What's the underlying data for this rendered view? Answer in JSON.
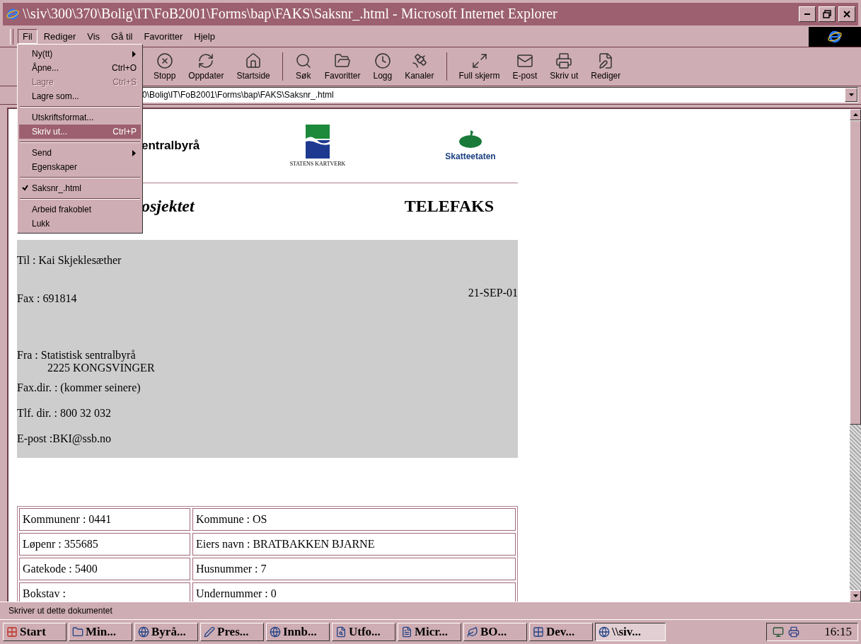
{
  "window": {
    "title": "\\\\siv\\300\\370\\Bolig\\IT\\FoB2001\\Forms\\bap\\FAKS\\Saksnr_.html - Microsoft Internet Explorer"
  },
  "menubar": [
    {
      "label": "Fil",
      "selected": true
    },
    {
      "label": "Rediger",
      "selected": false
    },
    {
      "label": "Vis",
      "selected": false
    },
    {
      "label": "Gå til",
      "selected": false
    },
    {
      "label": "Favoritter",
      "selected": false
    },
    {
      "label": "Hjelp",
      "selected": false
    }
  ],
  "toolbar": [
    [
      {
        "label": "Stopp"
      },
      {
        "label": "Oppdater"
      },
      {
        "label": "Startside"
      }
    ],
    [
      {
        "label": "Søk"
      },
      {
        "label": "Favoritter"
      },
      {
        "label": "Logg"
      },
      {
        "label": "Kanaler"
      }
    ],
    [
      {
        "label": "Full skjerm"
      },
      {
        "label": "E-post"
      },
      {
        "label": "Skriv ut"
      },
      {
        "label": "Rediger"
      }
    ]
  ],
  "address": {
    "value": "0\\Bolig\\IT\\FoB2001\\Forms\\bap\\FAKS\\Saksnr_.html"
  },
  "file_menu": [
    [
      {
        "label": "Ny(tt)",
        "submenu": true,
        "disabled": false,
        "checked": false,
        "selected": false
      },
      {
        "label": "Åpne...",
        "shortcut": "Ctrl+O",
        "submenu": false,
        "disabled": false,
        "checked": false,
        "selected": false
      },
      {
        "label": "Lagre",
        "shortcut": "Ctrl+S",
        "submenu": false,
        "disabled": true,
        "checked": false,
        "selected": false
      },
      {
        "label": "Lagre som...",
        "submenu": false,
        "disabled": false,
        "checked": false,
        "selected": false
      }
    ],
    [
      {
        "label": "Utskriftsformat...",
        "submenu": false,
        "disabled": false,
        "checked": false,
        "selected": false
      },
      {
        "label": "Skriv ut...",
        "shortcut": "Ctrl+P",
        "submenu": false,
        "disabled": false,
        "checked": false,
        "selected": true
      }
    ],
    [
      {
        "label": "Send",
        "submenu": true,
        "disabled": false,
        "checked": false,
        "selected": false
      },
      {
        "label": "Egenskaper",
        "submenu": false,
        "disabled": false,
        "checked": false,
        "selected": false
      }
    ],
    [
      {
        "label": "Saksnr_.html",
        "submenu": false,
        "disabled": false,
        "checked": true,
        "selected": false
      }
    ],
    [
      {
        "label": "Arbeid frakoblet",
        "submenu": false,
        "disabled": false,
        "checked": false,
        "selected": false
      },
      {
        "label": "Lukk",
        "submenu": false,
        "disabled": false,
        "checked": false,
        "selected": false
      }
    ]
  ],
  "page": {
    "ssb_text": "entralbyrå",
    "kartverk_text": "STATENS KARTVERK",
    "skatt_text": "Skatteetaten",
    "project": "osjektet",
    "heading": "TELEFAKS",
    "to": "Til : Kai Skjeklesæther",
    "fax": "Fax : 691814",
    "date": "21-SEP-01",
    "from": "Fra : Statistisk sentralbyrå",
    "from_address": "2225 KONGSVINGER",
    "contact": [
      "Fax.dir. : (kommer seinere)",
      "Tlf. dir. : 800 32 032",
      "E-post :BKI@ssb.no"
    ],
    "table": [
      [
        "Kommunenr : 0441",
        "Kommune : OS"
      ],
      [
        "Løpenr : 355685",
        "Eiers navn : BRATBAKKEN BJARNE"
      ],
      [
        "Gatekode : 5400",
        "Husnummer : 7"
      ],
      [
        "Bokstav :",
        "Undernummer : 0"
      ]
    ]
  },
  "status_bar": "Skriver ut dette dokumentet",
  "taskbar": {
    "start": "Start",
    "tasks": [
      {
        "label": "Min...",
        "selected": false
      },
      {
        "label": "Byrå...",
        "selected": false
      },
      {
        "label": "Pres...",
        "selected": false
      },
      {
        "label": "Innb...",
        "selected": false
      },
      {
        "label": "Utfo...",
        "selected": false
      },
      {
        "label": "Micr...",
        "selected": false
      },
      {
        "label": "BO...",
        "selected": false
      },
      {
        "label": "Dev...",
        "selected": false
      },
      {
        "label": "\\\\siv...",
        "selected": true
      }
    ],
    "clock": "16:15"
  }
}
